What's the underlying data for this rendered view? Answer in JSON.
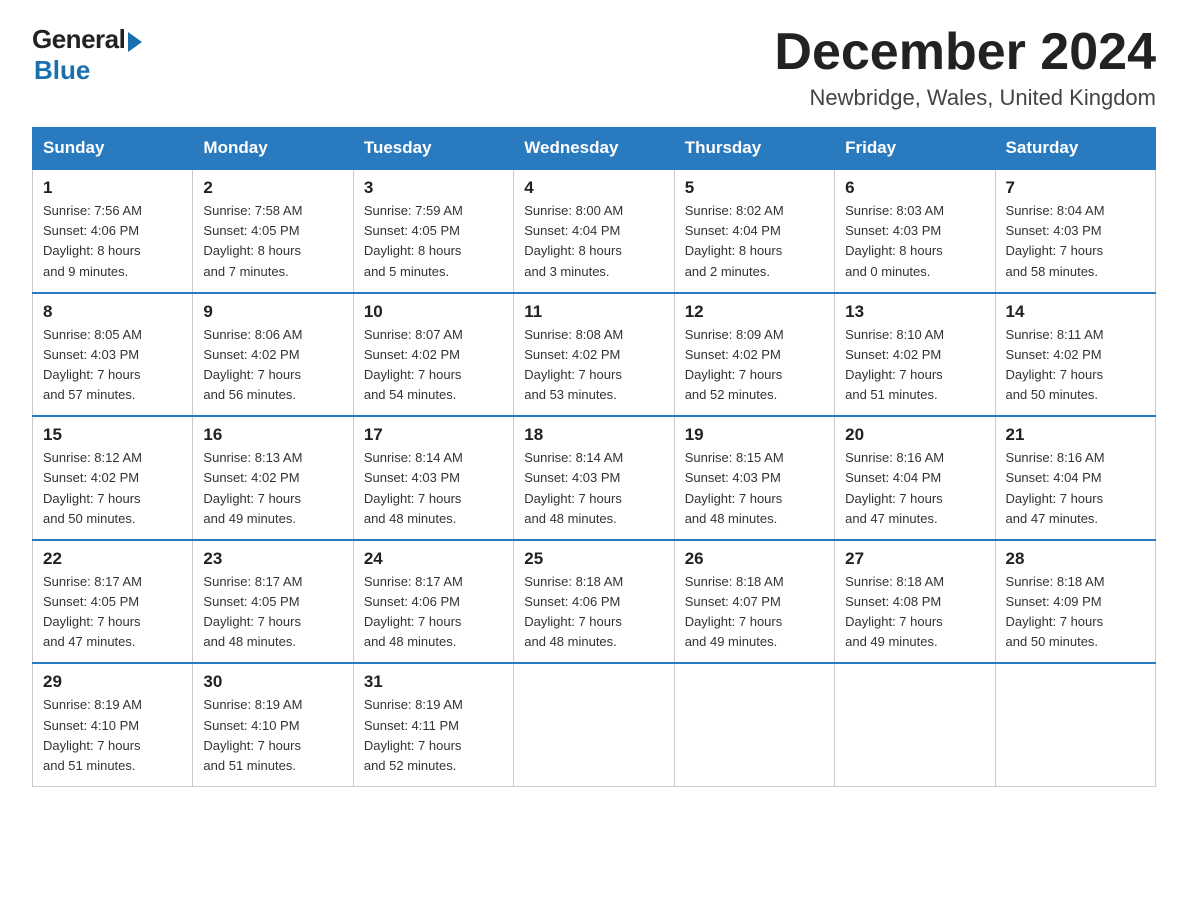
{
  "header": {
    "logo_general": "General",
    "logo_blue": "Blue",
    "month_title": "December 2024",
    "location": "Newbridge, Wales, United Kingdom"
  },
  "weekdays": [
    "Sunday",
    "Monday",
    "Tuesday",
    "Wednesday",
    "Thursday",
    "Friday",
    "Saturday"
  ],
  "weeks": [
    [
      {
        "day": "1",
        "sunrise": "7:56 AM",
        "sunset": "4:06 PM",
        "daylight": "8 hours and 9 minutes."
      },
      {
        "day": "2",
        "sunrise": "7:58 AM",
        "sunset": "4:05 PM",
        "daylight": "8 hours and 7 minutes."
      },
      {
        "day": "3",
        "sunrise": "7:59 AM",
        "sunset": "4:05 PM",
        "daylight": "8 hours and 5 minutes."
      },
      {
        "day": "4",
        "sunrise": "8:00 AM",
        "sunset": "4:04 PM",
        "daylight": "8 hours and 3 minutes."
      },
      {
        "day": "5",
        "sunrise": "8:02 AM",
        "sunset": "4:04 PM",
        "daylight": "8 hours and 2 minutes."
      },
      {
        "day": "6",
        "sunrise": "8:03 AM",
        "sunset": "4:03 PM",
        "daylight": "8 hours and 0 minutes."
      },
      {
        "day": "7",
        "sunrise": "8:04 AM",
        "sunset": "4:03 PM",
        "daylight": "7 hours and 58 minutes."
      }
    ],
    [
      {
        "day": "8",
        "sunrise": "8:05 AM",
        "sunset": "4:03 PM",
        "daylight": "7 hours and 57 minutes."
      },
      {
        "day": "9",
        "sunrise": "8:06 AM",
        "sunset": "4:02 PM",
        "daylight": "7 hours and 56 minutes."
      },
      {
        "day": "10",
        "sunrise": "8:07 AM",
        "sunset": "4:02 PM",
        "daylight": "7 hours and 54 minutes."
      },
      {
        "day": "11",
        "sunrise": "8:08 AM",
        "sunset": "4:02 PM",
        "daylight": "7 hours and 53 minutes."
      },
      {
        "day": "12",
        "sunrise": "8:09 AM",
        "sunset": "4:02 PM",
        "daylight": "7 hours and 52 minutes."
      },
      {
        "day": "13",
        "sunrise": "8:10 AM",
        "sunset": "4:02 PM",
        "daylight": "7 hours and 51 minutes."
      },
      {
        "day": "14",
        "sunrise": "8:11 AM",
        "sunset": "4:02 PM",
        "daylight": "7 hours and 50 minutes."
      }
    ],
    [
      {
        "day": "15",
        "sunrise": "8:12 AM",
        "sunset": "4:02 PM",
        "daylight": "7 hours and 50 minutes."
      },
      {
        "day": "16",
        "sunrise": "8:13 AM",
        "sunset": "4:02 PM",
        "daylight": "7 hours and 49 minutes."
      },
      {
        "day": "17",
        "sunrise": "8:14 AM",
        "sunset": "4:03 PM",
        "daylight": "7 hours and 48 minutes."
      },
      {
        "day": "18",
        "sunrise": "8:14 AM",
        "sunset": "4:03 PM",
        "daylight": "7 hours and 48 minutes."
      },
      {
        "day": "19",
        "sunrise": "8:15 AM",
        "sunset": "4:03 PM",
        "daylight": "7 hours and 48 minutes."
      },
      {
        "day": "20",
        "sunrise": "8:16 AM",
        "sunset": "4:04 PM",
        "daylight": "7 hours and 47 minutes."
      },
      {
        "day": "21",
        "sunrise": "8:16 AM",
        "sunset": "4:04 PM",
        "daylight": "7 hours and 47 minutes."
      }
    ],
    [
      {
        "day": "22",
        "sunrise": "8:17 AM",
        "sunset": "4:05 PM",
        "daylight": "7 hours and 47 minutes."
      },
      {
        "day": "23",
        "sunrise": "8:17 AM",
        "sunset": "4:05 PM",
        "daylight": "7 hours and 48 minutes."
      },
      {
        "day": "24",
        "sunrise": "8:17 AM",
        "sunset": "4:06 PM",
        "daylight": "7 hours and 48 minutes."
      },
      {
        "day": "25",
        "sunrise": "8:18 AM",
        "sunset": "4:06 PM",
        "daylight": "7 hours and 48 minutes."
      },
      {
        "day": "26",
        "sunrise": "8:18 AM",
        "sunset": "4:07 PM",
        "daylight": "7 hours and 49 minutes."
      },
      {
        "day": "27",
        "sunrise": "8:18 AM",
        "sunset": "4:08 PM",
        "daylight": "7 hours and 49 minutes."
      },
      {
        "day": "28",
        "sunrise": "8:18 AM",
        "sunset": "4:09 PM",
        "daylight": "7 hours and 50 minutes."
      }
    ],
    [
      {
        "day": "29",
        "sunrise": "8:19 AM",
        "sunset": "4:10 PM",
        "daylight": "7 hours and 51 minutes."
      },
      {
        "day": "30",
        "sunrise": "8:19 AM",
        "sunset": "4:10 PM",
        "daylight": "7 hours and 51 minutes."
      },
      {
        "day": "31",
        "sunrise": "8:19 AM",
        "sunset": "4:11 PM",
        "daylight": "7 hours and 52 minutes."
      },
      null,
      null,
      null,
      null
    ]
  ],
  "labels": {
    "sunrise": "Sunrise:",
    "sunset": "Sunset:",
    "daylight": "Daylight:"
  }
}
